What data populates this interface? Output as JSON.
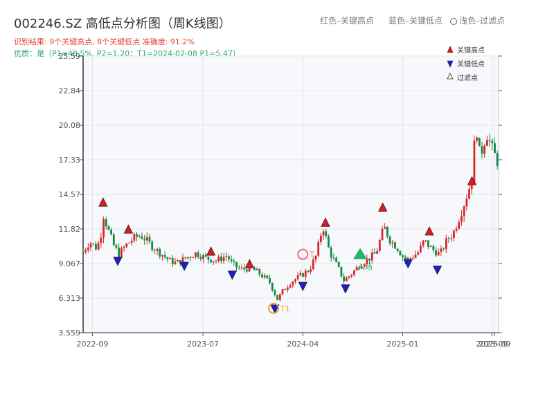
{
  "title": "002246.SZ 高低点分析图（周K线图）",
  "subtitle_result": "识别结果: 9个关键高点, 8个关键低点  准确度: 91.2%",
  "subtitle_quality": "优质：是（P1=48.5%, P2=1.20；T1=2024-02-08 P1=5.47）",
  "header_legend": {
    "high": "红色–关键高点",
    "low": "蓝色–关键低点",
    "filtered": "浅色–过滤点"
  },
  "colors": {
    "up": "#d9262c",
    "down": "#0f8a3e",
    "high_marker": "#e8141b",
    "low_marker": "#1c1cd8",
    "annot": "#f0a020",
    "entry": "#27b06a"
  },
  "chart_data": {
    "type": "candlestick",
    "title": "002246.SZ 高低点分析图（周K线图）",
    "ylim": [
      3.559,
      25.59
    ],
    "y_ticks": [
      "3.559",
      "6.313",
      "9.067",
      "11.82",
      "14.57",
      "17.33",
      "20.08",
      "22.84",
      "25.59"
    ],
    "y_tick_values": [
      3.559,
      6.313,
      9.067,
      11.82,
      14.57,
      17.33,
      20.08,
      22.84,
      25.59
    ],
    "x_range": [
      2022.6,
      2025.72
    ],
    "x_ticks": [
      "2022-09",
      "2023-07",
      "2024-04",
      "2025-01",
      "2025-09",
      "2025-09"
    ],
    "x_tick_values": [
      2022.67,
      2023.5,
      2024.25,
      2025.0,
      2025.67,
      2025.69
    ],
    "legend": {
      "placement": "top-right",
      "items": [
        "关键高点",
        "关键低点",
        "过滤点"
      ]
    },
    "close_series": [
      {
        "x": 2022.6,
        "y": 10.0
      },
      {
        "x": 2022.65,
        "y": 10.8
      },
      {
        "x": 2022.7,
        "y": 10.3
      },
      {
        "x": 2022.73,
        "y": 11.0
      },
      {
        "x": 2022.75,
        "y": 13.0
      },
      {
        "x": 2022.79,
        "y": 11.7
      },
      {
        "x": 2022.83,
        "y": 10.5
      },
      {
        "x": 2022.87,
        "y": 9.8
      },
      {
        "x": 2022.92,
        "y": 10.5
      },
      {
        "x": 2022.98,
        "y": 11.1
      },
      {
        "x": 2023.03,
        "y": 11.3
      },
      {
        "x": 2023.07,
        "y": 11.0
      },
      {
        "x": 2023.12,
        "y": 10.4
      },
      {
        "x": 2023.18,
        "y": 9.9
      },
      {
        "x": 2023.25,
        "y": 9.3
      },
      {
        "x": 2023.3,
        "y": 9.1
      },
      {
        "x": 2023.37,
        "y": 9.5
      },
      {
        "x": 2023.45,
        "y": 9.9
      },
      {
        "x": 2023.52,
        "y": 9.5
      },
      {
        "x": 2023.6,
        "y": 9.3
      },
      {
        "x": 2023.68,
        "y": 9.7
      },
      {
        "x": 2023.72,
        "y": 9.0
      },
      {
        "x": 2023.78,
        "y": 8.6
      },
      {
        "x": 2023.86,
        "y": 8.7
      },
      {
        "x": 2023.92,
        "y": 8.3
      },
      {
        "x": 2024.0,
        "y": 7.6
      },
      {
        "x": 2024.06,
        "y": 6.2
      },
      {
        "x": 2024.1,
        "y": 6.9
      },
      {
        "x": 2024.16,
        "y": 7.6
      },
      {
        "x": 2024.25,
        "y": 8.2
      },
      {
        "x": 2024.3,
        "y": 8.6
      },
      {
        "x": 2024.35,
        "y": 9.7
      },
      {
        "x": 2024.4,
        "y": 12.1
      },
      {
        "x": 2024.45,
        "y": 10.0
      },
      {
        "x": 2024.52,
        "y": 8.6
      },
      {
        "x": 2024.56,
        "y": 7.7
      },
      {
        "x": 2024.62,
        "y": 8.3
      },
      {
        "x": 2024.68,
        "y": 9.0
      },
      {
        "x": 2024.75,
        "y": 9.5
      },
      {
        "x": 2024.8,
        "y": 9.9
      },
      {
        "x": 2024.86,
        "y": 12.0
      },
      {
        "x": 2024.9,
        "y": 11.0
      },
      {
        "x": 2024.96,
        "y": 10.3
      },
      {
        "x": 2025.02,
        "y": 9.3
      },
      {
        "x": 2025.07,
        "y": 9.6
      },
      {
        "x": 2025.12,
        "y": 10.0
      },
      {
        "x": 2025.16,
        "y": 10.9
      },
      {
        "x": 2025.22,
        "y": 10.2
      },
      {
        "x": 2025.28,
        "y": 9.8
      },
      {
        "x": 2025.33,
        "y": 10.9
      },
      {
        "x": 2025.38,
        "y": 11.5
      },
      {
        "x": 2025.42,
        "y": 12.6
      },
      {
        "x": 2025.47,
        "y": 14.1
      },
      {
        "x": 2025.52,
        "y": 15.8
      },
      {
        "x": 2025.55,
        "y": 20.3
      },
      {
        "x": 2025.58,
        "y": 17.5
      },
      {
        "x": 2025.63,
        "y": 19.5
      },
      {
        "x": 2025.67,
        "y": 18.2
      },
      {
        "x": 2025.72,
        "y": 17.0
      }
    ],
    "key_highs": [
      {
        "x": 2022.75,
        "y": 13.9
      },
      {
        "x": 2022.94,
        "y": 11.75
      },
      {
        "x": 2023.56,
        "y": 10.0
      },
      {
        "x": 2023.85,
        "y": 9.0
      },
      {
        "x": 2024.42,
        "y": 12.3
      },
      {
        "x": 2024.85,
        "y": 13.5
      },
      {
        "x": 2025.2,
        "y": 11.6
      },
      {
        "x": 2025.52,
        "y": 15.6
      }
    ],
    "key_lows": [
      {
        "x": 2022.86,
        "y": 9.3
      },
      {
        "x": 2023.36,
        "y": 8.9
      },
      {
        "x": 2023.72,
        "y": 8.2
      },
      {
        "x": 2024.04,
        "y": 5.5
      },
      {
        "x": 2024.25,
        "y": 7.3
      },
      {
        "x": 2024.57,
        "y": 7.1
      },
      {
        "x": 2025.04,
        "y": 9.1
      },
      {
        "x": 2025.26,
        "y": 8.6
      }
    ],
    "annotations": [
      {
        "label": "T1",
        "x": 2024.03,
        "y": 5.5
      },
      {
        "label": "T",
        "x": 2024.25,
        "y": 9.8
      },
      {
        "label": "入场",
        "x": 2024.68,
        "y": 9.8
      }
    ]
  }
}
